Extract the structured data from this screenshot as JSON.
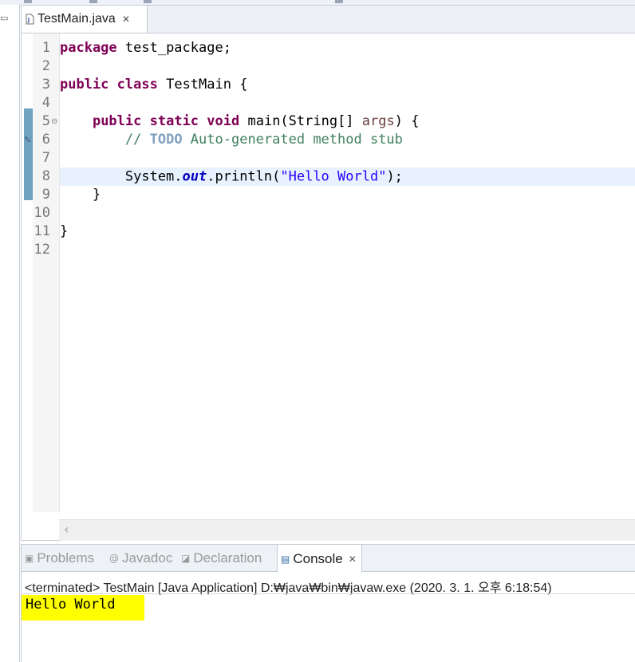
{
  "editor": {
    "tab": {
      "label": "TestMain.java",
      "close": "✕"
    },
    "lines": [
      {
        "num": "1",
        "segs": [
          {
            "t": "package",
            "c": "kw"
          },
          {
            "t": " test_package;",
            "c": ""
          }
        ]
      },
      {
        "num": "2",
        "segs": []
      },
      {
        "num": "3",
        "segs": [
          {
            "t": "public",
            "c": "kw"
          },
          {
            "t": " ",
            "c": ""
          },
          {
            "t": "class",
            "c": "kw"
          },
          {
            "t": " TestMain {",
            "c": ""
          }
        ]
      },
      {
        "num": "4",
        "segs": []
      },
      {
        "num": "5",
        "segs": [
          {
            "t": "    ",
            "c": ""
          },
          {
            "t": "public",
            "c": "kw"
          },
          {
            "t": " ",
            "c": ""
          },
          {
            "t": "static",
            "c": "kw"
          },
          {
            "t": " ",
            "c": ""
          },
          {
            "t": "void",
            "c": "kw"
          },
          {
            "t": " main(String[] ",
            "c": ""
          },
          {
            "t": "args",
            "c": "param"
          },
          {
            "t": ") {",
            "c": ""
          }
        ]
      },
      {
        "num": "6",
        "segs": [
          {
            "t": "        ",
            "c": ""
          },
          {
            "t": "// ",
            "c": "cm"
          },
          {
            "t": "TODO",
            "c": "todo"
          },
          {
            "t": " Auto-generated method stub",
            "c": "cm"
          }
        ]
      },
      {
        "num": "7",
        "segs": []
      },
      {
        "num": "8",
        "segs": [
          {
            "t": "        System.",
            "c": ""
          },
          {
            "t": "out",
            "c": "fld"
          },
          {
            "t": ".println(",
            "c": ""
          },
          {
            "t": "\"Hello World\"",
            "c": "str"
          },
          {
            "t": ");",
            "c": ""
          }
        ]
      },
      {
        "num": "9",
        "segs": [
          {
            "t": "    }",
            "c": ""
          }
        ]
      },
      {
        "num": "10",
        "segs": []
      },
      {
        "num": "11",
        "segs": [
          {
            "t": "}",
            "c": ""
          }
        ]
      },
      {
        "num": "12",
        "segs": []
      }
    ],
    "current_line": 8,
    "fold_marker": "⊖",
    "quickfix_marker": "✎"
  },
  "panel": {
    "tabs": [
      {
        "id": "problems",
        "label": "Problems",
        "icon": "▣",
        "icon_name": "problems-icon"
      },
      {
        "id": "javadoc",
        "label": "Javadoc",
        "icon": "@",
        "icon_name": "javadoc-icon"
      },
      {
        "id": "declaration",
        "label": "Declaration",
        "icon": "◪",
        "icon_name": "declaration-icon"
      },
      {
        "id": "console",
        "label": "Console",
        "icon": "▤",
        "icon_name": "console-icon",
        "active": true
      }
    ],
    "console_close": "✕",
    "terminated_line": "<terminated> TestMain [Java Application] D:₩java₩bin₩javaw.exe (2020. 3. 1. 오후 6:18:54)",
    "output": "Hello World",
    "highlight_color": "#ffff00"
  },
  "colors": {
    "keyword": "#7f0055",
    "comment": "#3f7f5f",
    "string": "#2a00ff",
    "field": "#0000c0",
    "current_line": "#e8f2fe"
  },
  "scrollbar": {
    "left_arrow": "‹"
  },
  "left_icon": "▭"
}
